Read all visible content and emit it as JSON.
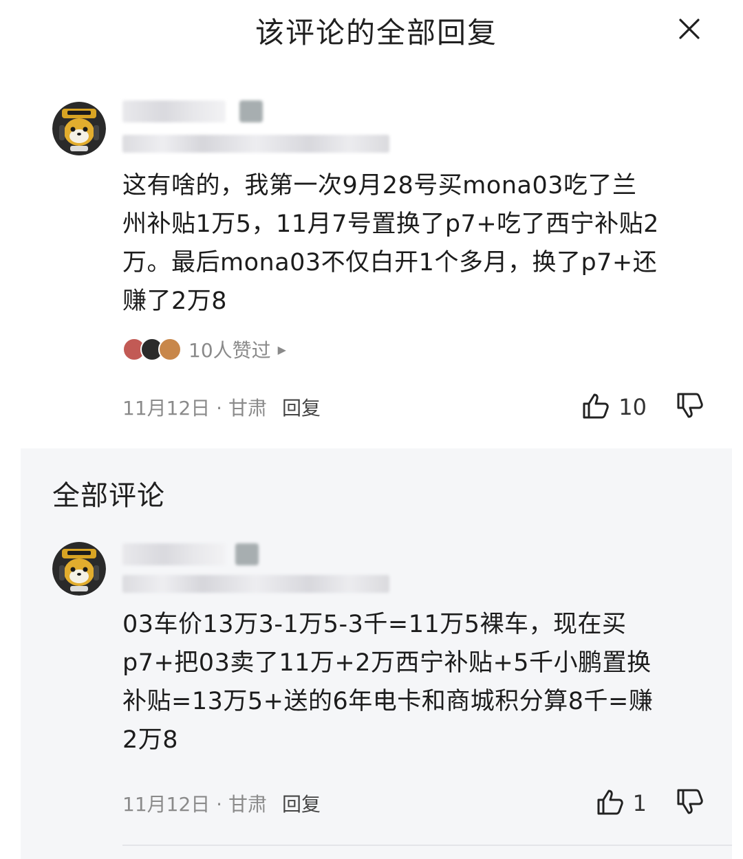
{
  "header": {
    "title": "该评论的全部回复",
    "close_icon": "close-icon"
  },
  "main_comment": {
    "text_lines": [
      "这有啥的，我第一次9月28号买mona03吃了兰",
      "州补贴1万5，11月7号置换了p7+吃了西宁补贴2",
      "万。最后mona03不仅白开1个多月，换了p7+还",
      "赚了2万8"
    ],
    "likers_text": "10人赞过",
    "date_location": "11月12日 · 甘肃",
    "reply_label": "回复",
    "like_count": "10"
  },
  "section": {
    "title": "全部评论"
  },
  "reply_comment": {
    "text_lines": [
      "03车价13万3-1万5-3千=11万5裸车，现在买",
      "p7+把03卖了11万+2万西宁补贴+5千小鹏置换",
      "补贴=13万5+送的6年电卡和商城积分算8千=赚",
      "2万8"
    ],
    "date_location": "11月12日 · 甘肃",
    "reply_label": "回复",
    "like_count": "1"
  },
  "colors": {
    "background": "#ffffff",
    "section_background": "#f5f6f8",
    "secondary_text": "#8a8a8a",
    "primary_text": "#1c1c1c"
  }
}
